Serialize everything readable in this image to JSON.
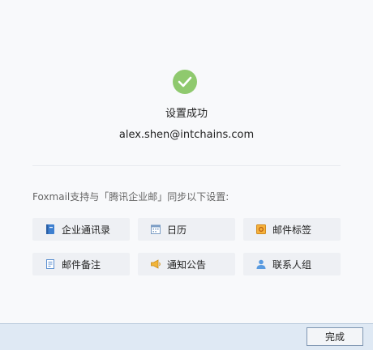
{
  "status": {
    "title": "设置成功",
    "email": "alex.shen@intchains.com"
  },
  "sync": {
    "label": "Foxmail支持与「腾讯企业邮」同步以下设置:",
    "items": [
      {
        "label": "企业通讯录",
        "icon": "address-book-icon"
      },
      {
        "label": "日历",
        "icon": "calendar-icon"
      },
      {
        "label": "邮件标签",
        "icon": "tag-icon"
      },
      {
        "label": "邮件备注",
        "icon": "note-icon"
      },
      {
        "label": "通知公告",
        "icon": "megaphone-icon"
      },
      {
        "label": "联系人组",
        "icon": "contact-group-icon"
      }
    ]
  },
  "footer": {
    "done_label": "完成"
  },
  "colors": {
    "success": "#8fc96e",
    "tile_bg": "#eef0f4",
    "footer_bg": "#dfe9f4"
  }
}
